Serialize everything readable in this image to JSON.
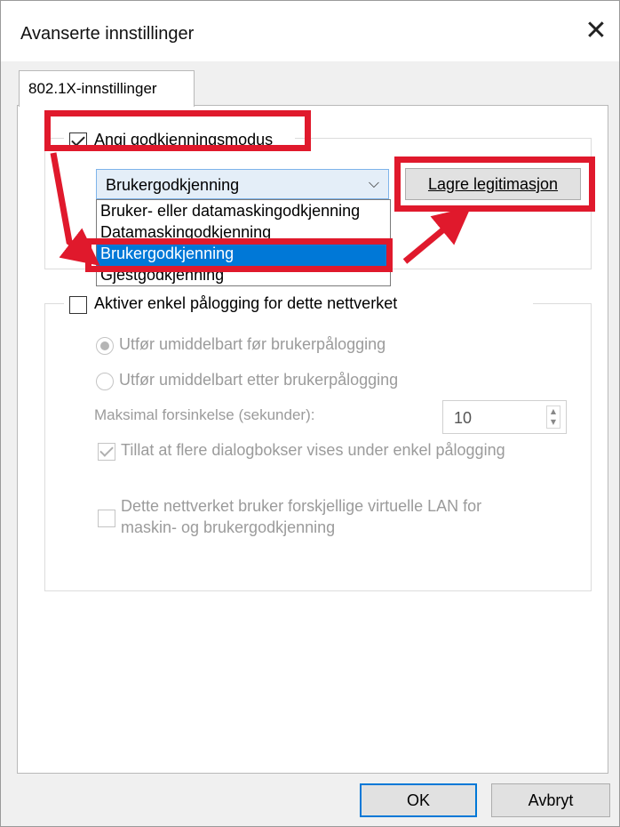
{
  "window": {
    "title": "Avanserte innstillinger",
    "close_glyph": "✕"
  },
  "tab": {
    "label": "802.1X-innstillinger"
  },
  "auth_mode": {
    "checkbox_label": "Angi godkjenningsmodus",
    "checked": true,
    "selected_value": "Brukergodkjenning",
    "save_button": "Lagre legitimasjon",
    "options": [
      "Bruker- eller datamaskingodkjenning",
      "Datamaskingodkjenning",
      "Brukergodkjenning",
      "Gjestgodkjenning"
    ]
  },
  "sso": {
    "checkbox_label": "Aktiver enkel pålogging for dette nettverket",
    "checked": false,
    "radio_before": "Utfør umiddelbart før brukerpålogging",
    "radio_after": "Utfør umiddelbart etter brukerpålogging",
    "delay_label": "Maksimal forsinkelse (sekunder):",
    "delay_value": "10",
    "allow_dialogs_label": "Tillat at flere dialogbokser vises under enkel pålogging",
    "vlan_label_line1": "Dette nettverket bruker forskjellige virtuelle LAN for",
    "vlan_label_line2": "maskin- og brukergodkjenning"
  },
  "buttons": {
    "ok": "OK",
    "cancel": "Avbryt"
  },
  "annotation_color": "#e0192c",
  "selection_color": "#0078d7"
}
